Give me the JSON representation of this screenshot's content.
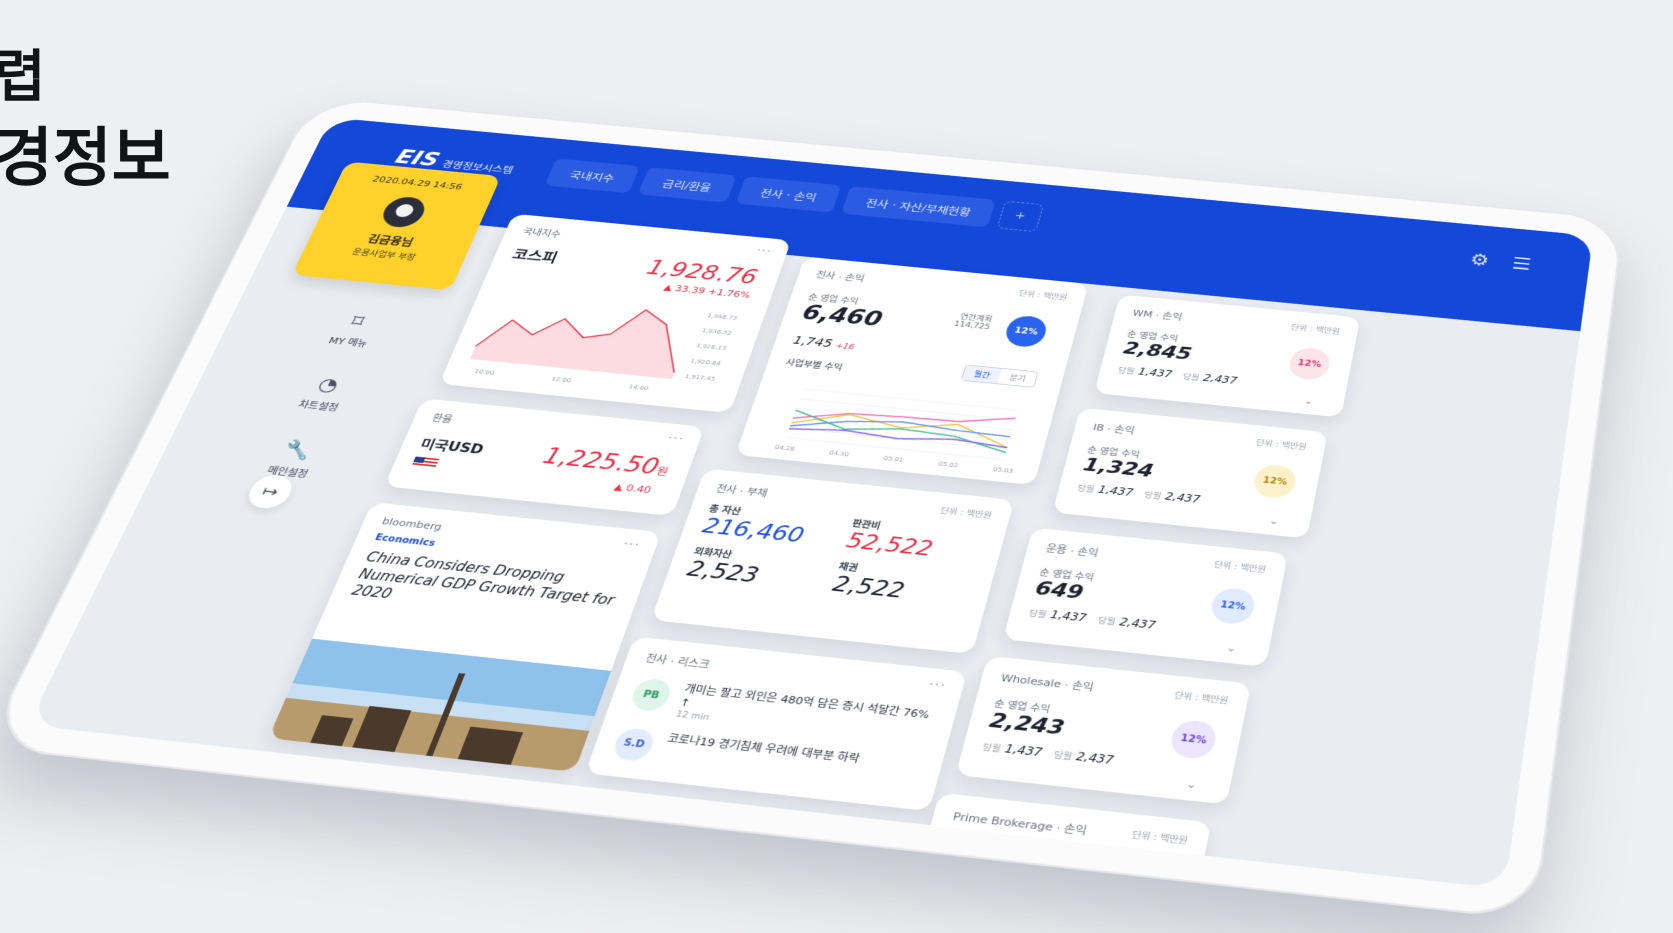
{
  "headline": {
    "line1": "렵",
    "line2": "경정보"
  },
  "app": {
    "logo": "EIS",
    "subtitle": "경영정보시스템"
  },
  "tabs": [
    "국내지수",
    "금리/환율",
    "전사 · 손익",
    "전사 · 자산/부채현황"
  ],
  "tab_add": "+",
  "profile": {
    "date": "2020.04.29  14:56",
    "name": "김금융님",
    "role": "운용사업부 부장"
  },
  "side_menu": [
    {
      "icon": "bookmark-icon",
      "glyph": "⌑",
      "label": "MY 메뉴"
    },
    {
      "icon": "pie-chart-icon",
      "glyph": "◔",
      "label": "차트설정"
    },
    {
      "icon": "wrench-icon",
      "glyph": "🔧",
      "label": "메인설정"
    }
  ],
  "logout_glyph": "↦",
  "kospi": {
    "title": "국내지수",
    "name": "코스피",
    "value": "1,928.76",
    "change": "▲ 33.39  +1.76%",
    "y_ticks": [
      "1,946.73",
      "1,936.52",
      "1,928.13",
      "1,920.84",
      "1,917.45"
    ],
    "x_ticks": [
      "10:00",
      "12:00",
      "14:00"
    ],
    "chart_data": {
      "type": "area",
      "x": [
        "10:00",
        "12:00",
        "14:00"
      ],
      "values": [
        1921,
        1935,
        1929,
        1938,
        1930,
        1933,
        1946,
        1940,
        1918
      ]
    }
  },
  "fx": {
    "title": "환율",
    "name": "미국USD",
    "value": "1,225.50",
    "unit": "원",
    "change": "▲ 0.40"
  },
  "news": {
    "source": "bloomberg",
    "category": "Economics",
    "headline": "China Considers Dropping Numerical GDP Growth Target for 2020"
  },
  "pnl": {
    "title": "전사 · 손익",
    "unit": "단위 : 백만원",
    "label": "순 영업 수익",
    "value": "6,460",
    "goal_label": "연간계획",
    "goal_value": "114,725",
    "pct": "12%",
    "sub_value": "1,745",
    "sub_change": "+16",
    "toggle": [
      "월간",
      "분기"
    ],
    "biz_title": "사업부별 수익",
    "chart_data": {
      "type": "line",
      "x": [
        "04.28",
        "04.30",
        "05.01",
        "05.02",
        "05.03"
      ],
      "series": [
        {
          "color": "#f06bb0",
          "values": [
            2000,
            3000,
            3200,
            3300,
            4200
          ]
        },
        {
          "color": "#f2c230",
          "values": [
            1500,
            2900,
            2100,
            3000,
            1200
          ]
        },
        {
          "color": "#5a8df5",
          "values": [
            1200,
            2200,
            2700,
            2400,
            2300
          ]
        },
        {
          "color": "#3cc08a",
          "values": [
            2800,
            1400,
            2000,
            1800,
            700
          ]
        },
        {
          "color": "#8a6cf0",
          "values": [
            900,
            1300,
            1000,
            1500,
            1200
          ]
        }
      ]
    }
  },
  "balance": {
    "title": "전사 · 부채",
    "unit": "단위 : 백만원",
    "total_assets_label": "총 자산",
    "total_assets": "216,460",
    "ratio_label": "판관비",
    "ratio": "52,522",
    "fx_assets_label": "외화자산",
    "fx_assets": "2,523",
    "bond_label": "채권",
    "bond": "2,522"
  },
  "risk": {
    "title": "전사 · 리스크",
    "items": [
      {
        "badge": "PB",
        "text": "개미는 팔고 외인은 480억 담은 증시 석달간 76% ↑",
        "time": "12 min"
      },
      {
        "badge": "S.D",
        "text": "코로나19 경기침체 우려에 대부분 하락",
        "time": ""
      }
    ]
  },
  "divisions": [
    {
      "title": "WM · 손익",
      "unit": "단위 : 백만원",
      "label": "순 영업 수익",
      "value": "2,845",
      "pct": "12%",
      "a_label": "당월",
      "a": "1,437",
      "b_label": "당월",
      "b": "2,437",
      "pct_color": "pink"
    },
    {
      "title": "IB · 손익",
      "unit": "단위 : 백만원",
      "label": "순 영업 수익",
      "value": "1,324",
      "pct": "12%",
      "a_label": "당월",
      "a": "1,437",
      "b_label": "당월",
      "b": "2,437",
      "pct_color": "yellow"
    },
    {
      "title": "운용 · 손익",
      "unit": "단위 : 백만원",
      "label": "순 영업 수익",
      "value": "649",
      "pct": "12%",
      "a_label": "당월",
      "a": "1,437",
      "b_label": "당월",
      "b": "2,437",
      "pct_color": "blue"
    },
    {
      "title": "Wholesale · 손익",
      "unit": "단위 : 백만원",
      "label": "순 영업 수익",
      "value": "2,243",
      "pct": "12%",
      "a_label": "당월",
      "a": "1,437",
      "b_label": "당월",
      "b": "2,437",
      "pct_color": "purple"
    },
    {
      "title": "Prime Brokerage · 손익",
      "unit": "단위 : 백만원"
    }
  ],
  "more_glyph": "···",
  "chevron_glyph": "⌄"
}
